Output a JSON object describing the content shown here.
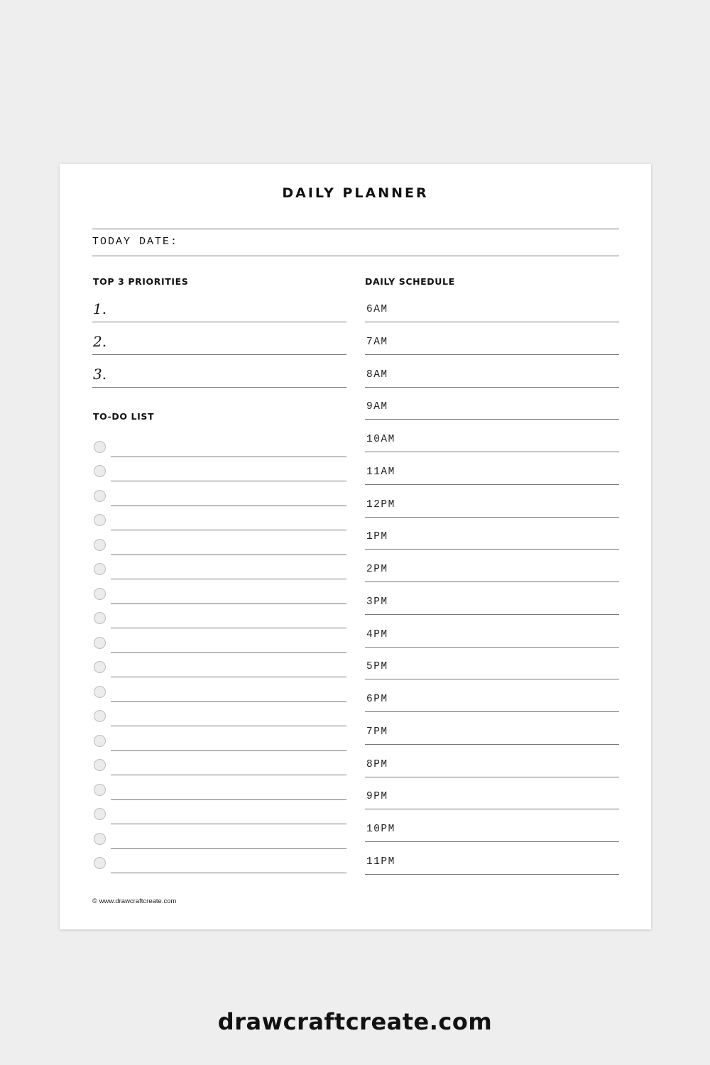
{
  "planner": {
    "title": "DAILY PLANNER",
    "date_label": "TODAY DATE:",
    "priorities": {
      "heading": "TOP 3 PRIORITIES",
      "items": [
        {
          "number": "1.",
          "value": ""
        },
        {
          "number": "2.",
          "value": ""
        },
        {
          "number": "3.",
          "value": ""
        }
      ]
    },
    "todo": {
      "heading": "TO-DO LIST",
      "item_count": 18,
      "items": [
        {
          "checked": false,
          "value": ""
        },
        {
          "checked": false,
          "value": ""
        },
        {
          "checked": false,
          "value": ""
        },
        {
          "checked": false,
          "value": ""
        },
        {
          "checked": false,
          "value": ""
        },
        {
          "checked": false,
          "value": ""
        },
        {
          "checked": false,
          "value": ""
        },
        {
          "checked": false,
          "value": ""
        },
        {
          "checked": false,
          "value": ""
        },
        {
          "checked": false,
          "value": ""
        },
        {
          "checked": false,
          "value": ""
        },
        {
          "checked": false,
          "value": ""
        },
        {
          "checked": false,
          "value": ""
        },
        {
          "checked": false,
          "value": ""
        },
        {
          "checked": false,
          "value": ""
        },
        {
          "checked": false,
          "value": ""
        },
        {
          "checked": false,
          "value": ""
        },
        {
          "checked": false,
          "value": ""
        }
      ]
    },
    "schedule": {
      "heading": "DAILY SCHEDULE",
      "times": [
        "6AM",
        "7AM",
        "8AM",
        "9AM",
        "10AM",
        "11AM",
        "12PM",
        "1PM",
        "2PM",
        "3PM",
        "4PM",
        "5PM",
        "6PM",
        "7PM",
        "8PM",
        "9PM",
        "10PM",
        "11PM"
      ]
    },
    "copyright": "© www.drawcraftcreate.com"
  },
  "footer": {
    "brand": "drawcraftcreate.com"
  },
  "colors": {
    "background": "#eeeeee",
    "page": "#ffffff",
    "line": "#777777",
    "checkbox_fill": "#ececec",
    "checkbox_border": "#bdbdbd",
    "text": "#111111"
  }
}
